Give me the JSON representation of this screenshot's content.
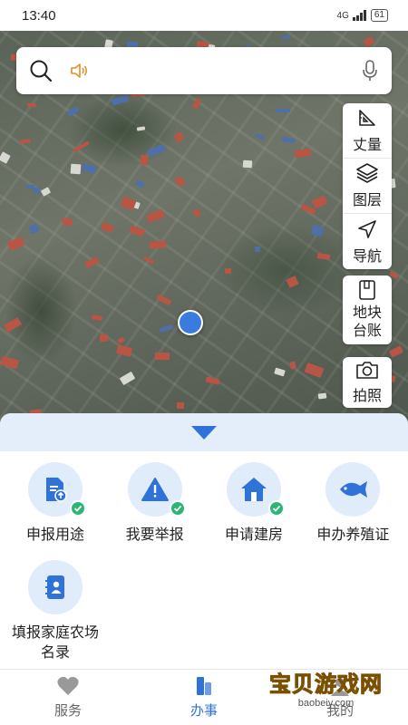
{
  "status": {
    "time": "13:40",
    "network": "4G",
    "battery": "61"
  },
  "search": {
    "placeholder": ""
  },
  "tools": [
    {
      "label": "丈量",
      "icon": "ruler-icon"
    },
    {
      "label": "图层",
      "icon": "layers-icon"
    },
    {
      "label": "导航",
      "icon": "navigate-icon"
    }
  ],
  "tools2": [
    {
      "label": "地块\n台账",
      "icon": "ledger-icon"
    },
    {
      "label": "拍照",
      "icon": "camera-icon"
    }
  ],
  "services": [
    {
      "label": "申报用途",
      "icon": "document-upload-icon",
      "checked": true
    },
    {
      "label": "我要举报",
      "icon": "warning-icon",
      "checked": true
    },
    {
      "label": "申请建房",
      "icon": "house-icon",
      "checked": true
    },
    {
      "label": "申办养殖证",
      "icon": "fish-icon",
      "checked": false
    },
    {
      "label": "填报家庭农场名录",
      "icon": "contacts-book-icon",
      "checked": false
    }
  ],
  "tabs": [
    {
      "label": "服务",
      "icon": "heart-icon",
      "active": false
    },
    {
      "label": "办事",
      "icon": "office-icon",
      "active": true
    },
    {
      "label": "我的",
      "icon": "user-icon",
      "active": false
    }
  ],
  "watermark": {
    "text": "宝贝游戏网",
    "url": "baobeiy.com"
  },
  "colors": {
    "accent": "#2f73d8",
    "sheet_header": "#e3eefa",
    "icon_bg": "#e1ecfa",
    "check": "#2bb673"
  }
}
